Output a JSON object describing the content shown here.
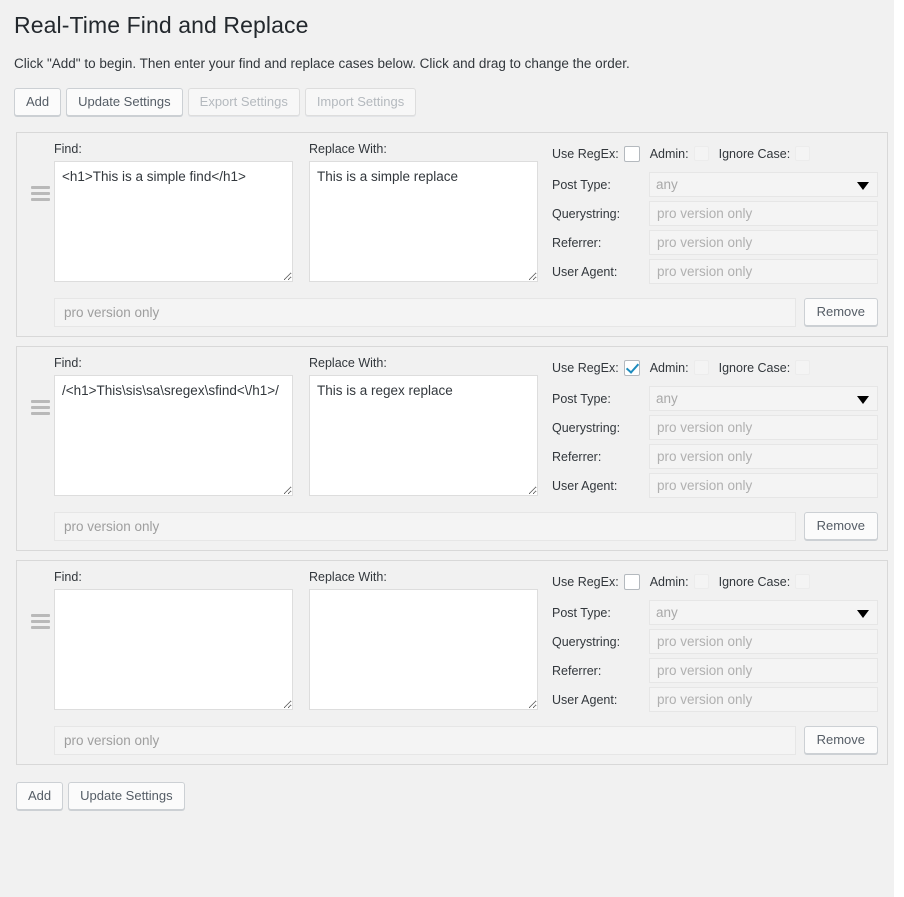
{
  "page": {
    "title": "Real-Time Find and Replace",
    "description": "Click \"Add\" to begin. Then enter your find and replace cases below. Click and drag to change the order."
  },
  "toolbar_top": {
    "buttons": [
      {
        "label": "Add",
        "disabled": false
      },
      {
        "label": "Update Settings",
        "disabled": false
      },
      {
        "label": "Export Settings",
        "disabled": true
      },
      {
        "label": "Import Settings",
        "disabled": true
      }
    ]
  },
  "toolbar_bottom": {
    "buttons": [
      {
        "label": "Add",
        "disabled": false
      },
      {
        "label": "Update Settings",
        "disabled": false
      }
    ]
  },
  "labels": {
    "find": "Find:",
    "replace_with": "Replace With:",
    "use_regex": "Use RegEx:",
    "admin": "Admin:",
    "ignore_case": "Ignore Case:",
    "post_type": "Post Type:",
    "querystring": "Querystring:",
    "referrer": "Referrer:",
    "user_agent": "User Agent:",
    "remove": "Remove"
  },
  "placeholders": {
    "pro_version_only": "pro version only",
    "note": "pro version only"
  },
  "post_type_options": [
    "any"
  ],
  "colors": {
    "page_background": "#f1f1f1",
    "panel_background": "#f1f1f1",
    "panel_border": "#d8d8d8",
    "text": "#32373c",
    "title": "#23282d",
    "checkbox_accent": "#1e8cbe",
    "disabled_text": "#b4b9be",
    "placeholder_text": "#b0b0b0",
    "input_disabled_bg": "#f4f4f4"
  },
  "rows": [
    {
      "find_value": "<h1>This is a simple find</h1>",
      "replace_value": "This is a simple replace",
      "use_regex_checked": false,
      "admin_checked": false,
      "ignore_case_checked": false,
      "post_type_value": "any",
      "querystring_value": "",
      "referrer_value": "",
      "user_agent_value": "",
      "note_value": ""
    },
    {
      "find_value": "/<h1>This\\sis\\sa\\sregex\\sfind<\\/h1>/",
      "replace_value": "This is a regex replace",
      "use_regex_checked": true,
      "admin_checked": false,
      "ignore_case_checked": false,
      "post_type_value": "any",
      "querystring_value": "",
      "referrer_value": "",
      "user_agent_value": "",
      "note_value": ""
    },
    {
      "find_value": "",
      "replace_value": "",
      "use_regex_checked": false,
      "admin_checked": false,
      "ignore_case_checked": false,
      "post_type_value": "any",
      "querystring_value": "",
      "referrer_value": "",
      "user_agent_value": "",
      "note_value": ""
    }
  ]
}
